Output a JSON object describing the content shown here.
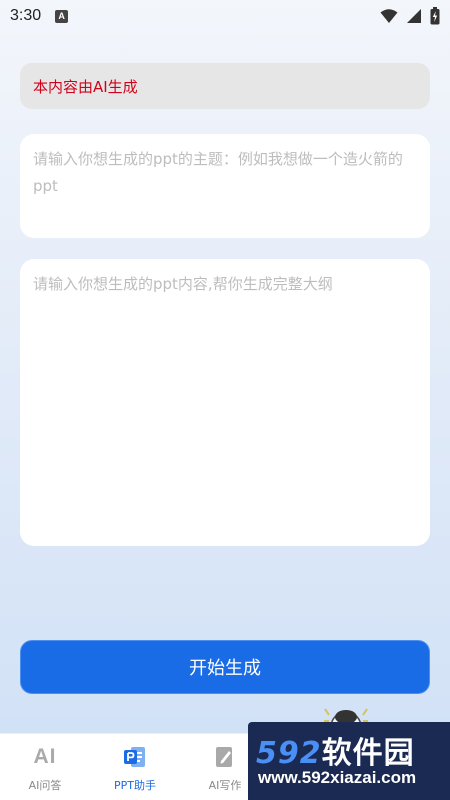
{
  "status_bar": {
    "time": "3:30",
    "notification_badge": "A",
    "icons": [
      "wifi-icon",
      "signal-icon",
      "battery-icon"
    ]
  },
  "notice": {
    "text": "本内容由AI生成",
    "color": "#d0021b"
  },
  "topic_input": {
    "placeholder": "请输入你想生成的ppt的主题：例如我想做一个造火箭的ppt",
    "value": ""
  },
  "content_input": {
    "placeholder": "请输入你想生成的ppt内容,帮你生成完整大纲",
    "value": ""
  },
  "start_button": {
    "label": "开始生成",
    "color": "#1a6be6"
  },
  "bottom_nav": {
    "items": [
      {
        "label": "AI问答",
        "icon": "ai-icon",
        "active": false
      },
      {
        "label": "PPT助手",
        "icon": "ppt-icon",
        "active": true
      },
      {
        "label": "AI写作",
        "icon": "write-icon",
        "active": false
      },
      {
        "label": "",
        "icon": "tool-icon",
        "active": false
      },
      {
        "label": "",
        "icon": "profile-icon",
        "active": false
      }
    ],
    "ai_glyph": "AI",
    "active_color": "#1a6be6"
  },
  "watermark": {
    "logo_number": "592",
    "logo_text": "软件园",
    "url": "www.592xiazai.com"
  }
}
